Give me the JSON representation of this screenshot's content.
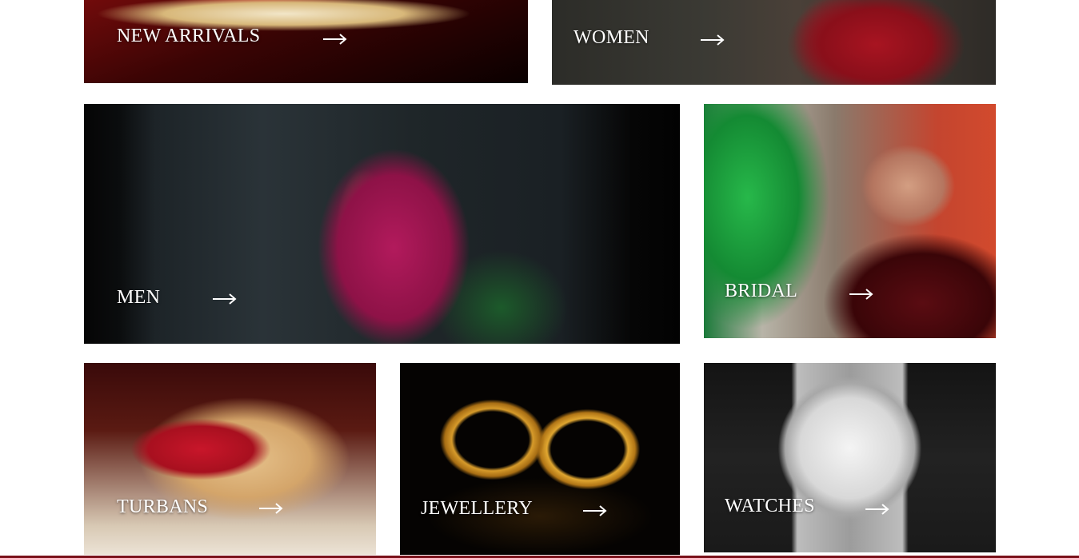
{
  "categories": [
    {
      "id": "new",
      "label": "NEW ARRIVALS"
    },
    {
      "id": "women",
      "label": "WOMEN"
    },
    {
      "id": "men",
      "label": "MEN"
    },
    {
      "id": "bridal",
      "label": "BRIDAL"
    },
    {
      "id": "turbans",
      "label": "TURBANS"
    },
    {
      "id": "jewellery",
      "label": "JEWELLERY"
    },
    {
      "id": "watches",
      "label": "WATCHES"
    }
  ],
  "icons": {
    "arrow": "arrow-right-icon"
  },
  "colors": {
    "label_text": "#ffffff",
    "footer_rule": "#7a1019"
  }
}
